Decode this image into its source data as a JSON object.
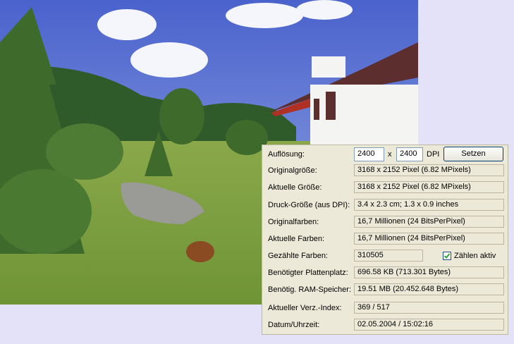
{
  "photo": {
    "sky_color": "#5a72d4",
    "grass_color": "#7e9e3e",
    "forest_color": "#2f5a2a",
    "house_wall_color": "#f4f4f2",
    "roof_color": "#5c2e2e"
  },
  "info": {
    "resolution": {
      "label": "Auflösung:",
      "x_value": "2400",
      "separator": "x",
      "y_value": "2400",
      "unit": "DPI",
      "set_button": "Setzen"
    },
    "original_size": {
      "label": "Originalgröße:",
      "value": "3168 x 2152 Pixel (6.82 MPixels)"
    },
    "current_size": {
      "label": "Aktuelle Größe:",
      "value": "3168 x 2152  Pixel (6.82 MPixels)"
    },
    "print_size": {
      "label": "Druck-Größe (aus DPI):",
      "value": "3.4 x 2.3 cm; 1.3 x 0.9 inches"
    },
    "original_colors": {
      "label": "Originalfarben:",
      "value": "16,7 Millionen   (24 BitsPerPixel)"
    },
    "current_colors": {
      "label": "Aktuelle Farben:",
      "value": "16,7 Millionen   (24 BitsPerPixel)"
    },
    "counted_colors": {
      "label": "Gezählte Farben:",
      "value": "310505",
      "checkbox_label": "Zählen aktiv",
      "checked": true
    },
    "disk_space": {
      "label": "Benötigter Plattenplatz:",
      "value": "696.58 KB (713.301 Bytes)"
    },
    "ram": {
      "label": "Benötig. RAM-Speicher:",
      "value": "19.51  MB (20.452.648 Bytes)"
    },
    "dir_index": {
      "label": "Aktueller Verz.-Index:",
      "value": "369  /  517"
    },
    "datetime": {
      "label": "Datum/Uhrzeit:",
      "value": "02.05.2004 / 15:02:16"
    }
  }
}
